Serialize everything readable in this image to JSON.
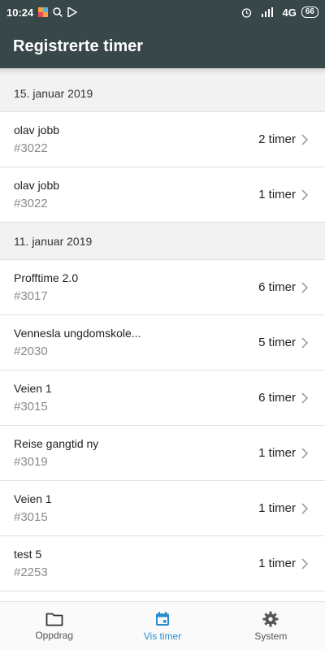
{
  "status": {
    "time": "10:24",
    "network": "4G",
    "battery": "66"
  },
  "appbar": {
    "title": "Registrerte timer"
  },
  "list": {
    "sections": [
      {
        "date": "15. januar 2019",
        "rows": [
          {
            "name": "olav jobb",
            "code": "#3022",
            "hours": "2 timer"
          },
          {
            "name": "olav jobb",
            "code": "#3022",
            "hours": "1 timer"
          }
        ]
      },
      {
        "date": "11. januar 2019",
        "rows": [
          {
            "name": "Profftime 2.0",
            "code": "#3017",
            "hours": "6 timer"
          },
          {
            "name": "Vennesla ungdomskole...",
            "code": "#2030",
            "hours": "5 timer"
          },
          {
            "name": "Veien 1",
            "code": "#3015",
            "hours": "6 timer"
          },
          {
            "name": "Reise gangtid ny",
            "code": "#3019",
            "hours": "1 timer"
          },
          {
            "name": "Veien 1",
            "code": "#3015",
            "hours": "1 timer"
          },
          {
            "name": "test 5",
            "code": "#2253",
            "hours": "1 timer"
          }
        ]
      }
    ]
  },
  "nav": {
    "tabs": [
      {
        "label": "Oppdrag",
        "icon": "folder-icon",
        "active": false
      },
      {
        "label": "Vis timer",
        "icon": "calendar-icon",
        "active": true
      },
      {
        "label": "System",
        "icon": "gear-icon",
        "active": false
      }
    ]
  },
  "colors": {
    "header": "#37474a",
    "accent": "#2b8ccf"
  }
}
